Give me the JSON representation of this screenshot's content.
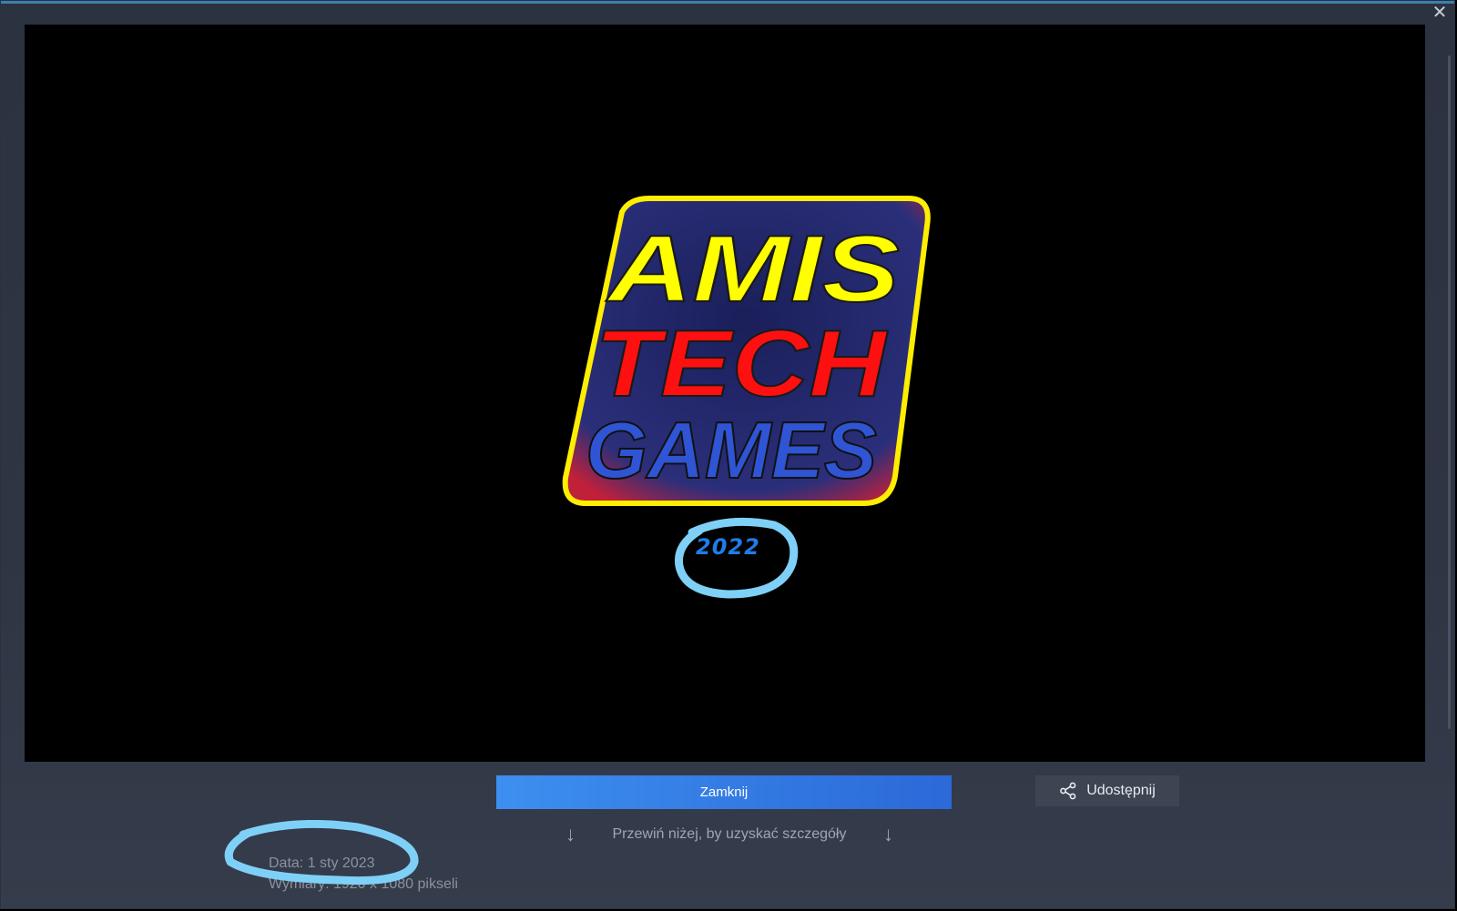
{
  "window": {
    "close_glyph": "✕"
  },
  "screenshot": {
    "logo": {
      "line1": "AMIS",
      "line2": "TECH",
      "line3": "GAMES",
      "year": "2022",
      "colors": {
        "line1": "#ffff00",
        "line2": "#ff1010",
        "line3": "#2f55d4",
        "border": "#ffee00",
        "panel": "#222a6a"
      }
    },
    "annotation_color": "#7fd0f7"
  },
  "actions": {
    "close_label": "Zamknij",
    "share_label": "Udostępnij",
    "share_icon": "share-icon"
  },
  "scroll_hint": {
    "text": "Przewiń niżej, by uzyskać szczegóły",
    "arrow": "↓"
  },
  "details": {
    "date": "Data: 1 sty 2023",
    "dimensions": "Wymiary: 1920 x 1080 pikseli"
  }
}
